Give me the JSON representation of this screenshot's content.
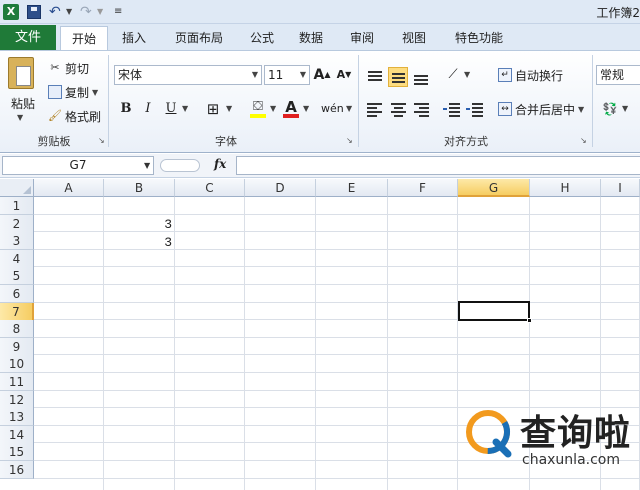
{
  "app": {
    "title": "工作簿2",
    "icon": "X"
  },
  "quick_access": {
    "icons": [
      "excel-app-icon",
      "save-icon",
      "undo-icon",
      "redo-icon",
      "customize-icon"
    ]
  },
  "tabs": {
    "file": "文件",
    "home": "开始",
    "insert": "插入",
    "page_layout": "页面布局",
    "formulas": "公式",
    "data": "数据",
    "review": "审阅",
    "view": "视图",
    "special": "特色功能"
  },
  "clipboard": {
    "paste": "粘贴",
    "cut": "剪切",
    "copy": "复制",
    "format_painter": "格式刷",
    "group_label": "剪贴板"
  },
  "font": {
    "font_name": "宋体",
    "font_size": "11",
    "grow": "A",
    "shrink": "A",
    "bold": "B",
    "italic": "I",
    "underline": "U",
    "font_color_letter": "A",
    "phonetic": "wén",
    "group_label": "字体"
  },
  "alignment": {
    "wrap_text": "自动换行",
    "merge_center": "合并后居中",
    "group_label": "对齐方式"
  },
  "number": {
    "format": "常规"
  },
  "formula_bar": {
    "name_box": "G7",
    "fx": "fx",
    "formula": ""
  },
  "sheet": {
    "columns": [
      "A",
      "B",
      "C",
      "D",
      "E",
      "F",
      "G",
      "H",
      "I"
    ],
    "rows": [
      "1",
      "2",
      "3",
      "4",
      "5",
      "6",
      "7",
      "8",
      "9",
      "10",
      "11",
      "12",
      "13",
      "14",
      "15",
      "16"
    ],
    "selected_column": "G",
    "selected_row": "7",
    "cells": {
      "B2": "3",
      "B3": "3"
    }
  },
  "watermark": {
    "title": "查询啦",
    "url": "chaxunla.com"
  },
  "colors": {
    "file_tab": "#1f7a38",
    "selection_header": "#f6cd62",
    "watermark_orange": "#f29a1e",
    "watermark_blue": "#1a6fb6"
  }
}
